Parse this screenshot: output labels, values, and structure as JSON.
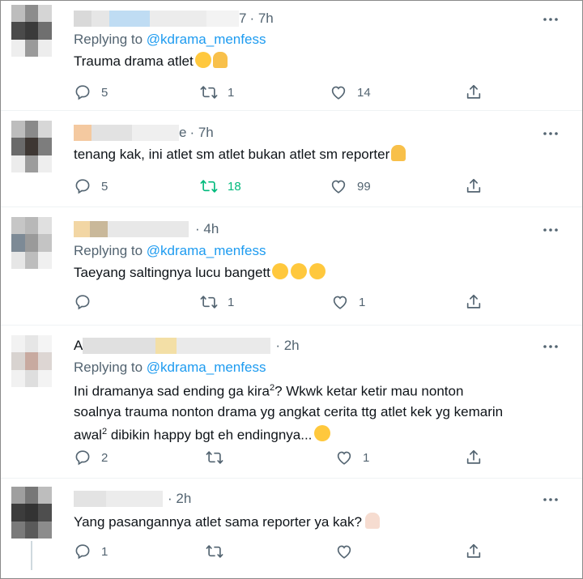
{
  "tweets": [
    {
      "name_tail": "7",
      "time": "· 7h",
      "reply_label": "Replying to",
      "reply_handle": "@kdrama_menfess",
      "text": "Trauma drama atlet",
      "replies": "5",
      "retweets": "1",
      "likes": "14"
    },
    {
      "name_tail": "e",
      "time": "· 7h",
      "text": "tenang kak, ini atlet sm atlet bukan atlet sm reporter",
      "replies": "5",
      "retweets": "18",
      "likes": "99"
    },
    {
      "time": "· 4h",
      "reply_label": "Replying to",
      "reply_handle": "@kdrama_menfess",
      "text": "Taeyang saltingnya lucu bangett",
      "replies": "",
      "retweets": "1",
      "likes": "1"
    },
    {
      "name_head": "A",
      "time": "· 2h",
      "reply_label": "Replying to",
      "reply_handle": "@kdrama_menfess",
      "text_part1": "Ini dramanya sad ending ga kira",
      "sup1": "2",
      "text_part2": "? Wkwk ketar ketir mau nonton soalnya trauma nonton drama yg angkat cerita ttg atlet kek yg kemarin awal",
      "sup2": "2",
      "text_part3": " dibikin happy bgt eh endingnya...",
      "replies": "2",
      "retweets": "",
      "likes": "1"
    },
    {
      "time": "· 2h",
      "text": "Yang pasangannya atlet sama reporter ya kak?",
      "replies": "1",
      "retweets": "",
      "likes": ""
    }
  ],
  "colors": {
    "handle": "#1d9bf0",
    "muted": "#536471",
    "retweet_active": "#00ba7c"
  },
  "icons": [
    "reply-icon",
    "retweet-icon",
    "like-icon",
    "share-icon",
    "more-icon"
  ]
}
